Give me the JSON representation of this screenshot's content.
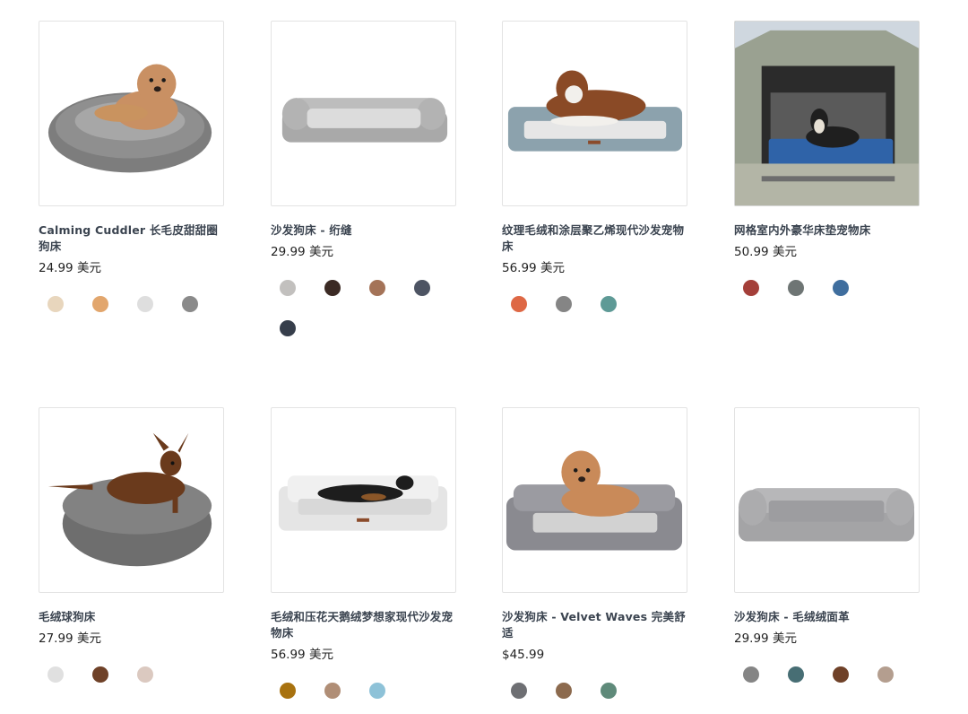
{
  "products": [
    {
      "title": "Calming Cuddler 长毛皮甜甜圈狗床",
      "price": "24.99 美元",
      "image_icon": "donut-dog-bed-poodle-image",
      "swatches": [
        "#e8d6bd",
        "#e2a66d",
        "#dedede",
        "#8a8a8a"
      ]
    },
    {
      "title": "沙发狗床 - 绗缝",
      "price": "29.99 美元",
      "image_icon": "quilted-sofa-bed-image",
      "swatches": [
        "#c2c0be",
        "#3b2a24",
        "#a47358",
        "#4d5463",
        "#363e4b"
      ]
    },
    {
      "title": "纹理毛绒和涂层聚乙烯现代沙发宠物床",
      "price": "56.99 美元",
      "image_icon": "blue-sofa-bed-collie-image",
      "swatches": [
        "#de6845",
        "#858585",
        "#5e9a96"
      ]
    },
    {
      "title": "网格室内外豪华床垫宠物床",
      "price": "50.99 美元",
      "image_icon": "car-trunk-mattress-dog-image",
      "swatches": [
        "#a43f39",
        "#6e7574",
        "#3f6e9e"
      ]
    },
    {
      "title": "毛绒球狗床",
      "price": "27.99 美元",
      "image_icon": "plush-ball-bed-pinscher-image",
      "swatches": [
        "#e0e0e0",
        "#6f4128",
        "#dbc9c0"
      ]
    },
    {
      "title": "毛绒和压花天鹅绒梦想家现代沙发宠物床",
      "price": "56.99 美元",
      "image_icon": "white-sofa-bed-sleeping-dog-image",
      "swatches": [
        "#a8720f",
        "#b08e76",
        "#8ec2d8"
      ]
    },
    {
      "title": "沙发狗床 - Velvet Waves 完美舒适",
      "price": "$45.99",
      "image_icon": "velvet-sofa-bed-doodle-image",
      "swatches": [
        "#6e6f73",
        "#8c6a4e",
        "#5f8a7a"
      ]
    },
    {
      "title": "沙发狗床 - 毛绒绒面革",
      "price": "29.99 美元",
      "image_icon": "grey-suede-sofa-bed-image",
      "swatches": [
        "#858585",
        "#476e74",
        "#6f4128",
        "#b49e8f"
      ]
    }
  ]
}
